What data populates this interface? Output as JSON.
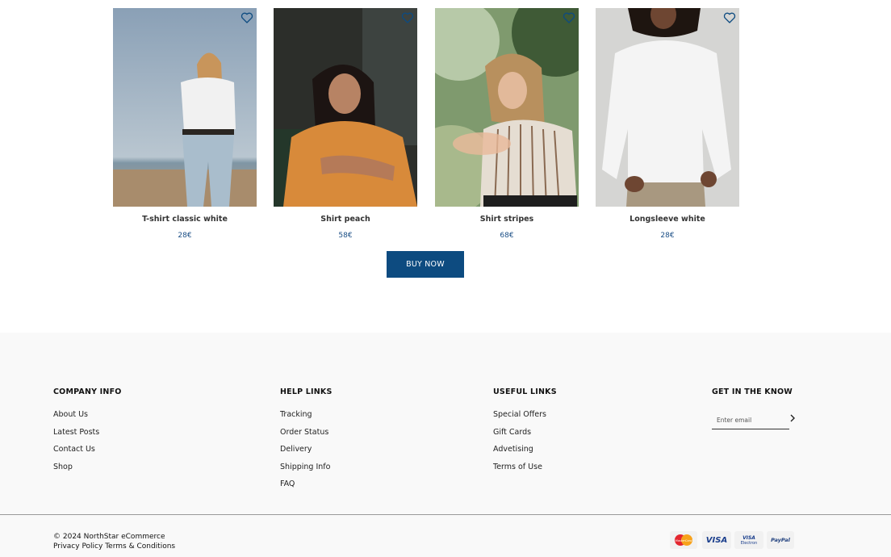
{
  "products": [
    {
      "name": "T-shirt classic white",
      "price": "28€"
    },
    {
      "name": "Shirt peach",
      "price": "58€"
    },
    {
      "name": "Shirt stripes",
      "price": "68€"
    },
    {
      "name": "Longsleeve white",
      "price": "28€"
    }
  ],
  "buy_label": "BUY NOW",
  "footer": {
    "company": {
      "title": "COMPANY INFO",
      "items": [
        "About Us",
        "Latest Posts",
        "Contact Us",
        "Shop"
      ]
    },
    "help": {
      "title": "HELP LINKS",
      "items": [
        "Tracking",
        "Order Status",
        "Delivery",
        "Shipping Info",
        "FAQ"
      ]
    },
    "useful": {
      "title": "USEFUL LINKS",
      "items": [
        "Special Offers",
        "Gift Cards",
        "Advetising",
        "Terms of Use"
      ]
    },
    "newsletter": {
      "title": "GET IN THE KNOW",
      "placeholder": "Enter email"
    },
    "copyright": "© 2024 NorthStar eCommerce",
    "privacy": "Privacy Policy",
    "terms": "Terms & Conditions",
    "payments": {
      "mastercard": "MasterCard",
      "visa": "VISA",
      "visa_electron_1": "VISA",
      "visa_electron_2": "Electron",
      "paypal": "PayPal"
    }
  },
  "colors": {
    "accent": "#0d4b80",
    "price": "#1b4f86",
    "footer_bg": "#f9f9f9"
  },
  "icons": {
    "favorite": "heart-icon",
    "submit": "chevron-right-icon"
  }
}
